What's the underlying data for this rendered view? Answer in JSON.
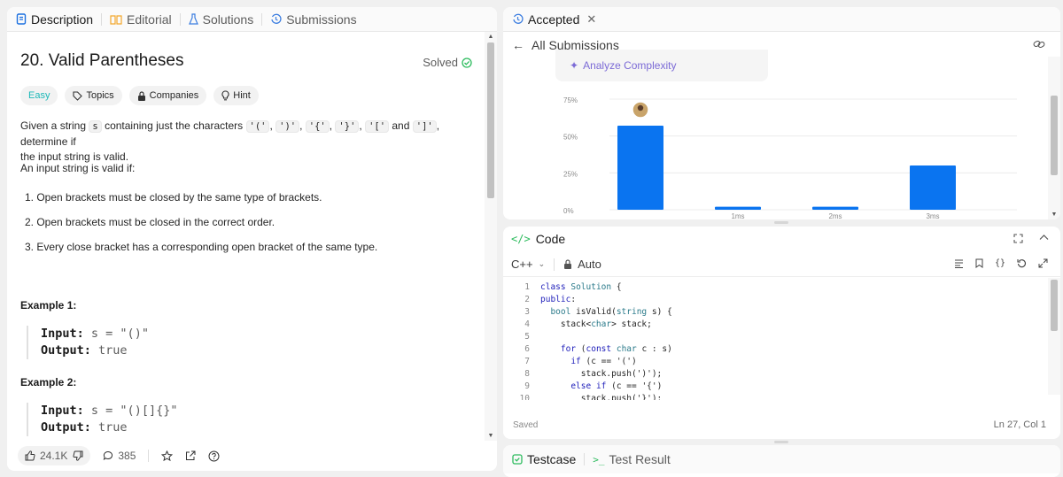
{
  "left": {
    "tabs": [
      {
        "label": "Description",
        "icon": "description-icon"
      },
      {
        "label": "Editorial",
        "icon": "book-icon"
      },
      {
        "label": "Solutions",
        "icon": "flask-icon"
      },
      {
        "label": "Submissions",
        "icon": "history-icon"
      }
    ],
    "problem": {
      "title": "20. Valid Parentheses",
      "status": "Solved",
      "tags": [
        "Easy",
        "Topics",
        "Companies",
        "Hint"
      ],
      "statement_prefix": "Given a string",
      "statement_var": "s",
      "statement_mid": "containing just the characters",
      "chars": [
        "'('",
        "')'",
        "'{'",
        "'}'",
        "'['"
      ],
      "and_word": "and",
      "last_char": "']'",
      "statement_suffix": ", determine if",
      "statement_line2": "the input string is valid.",
      "valid_if": "An input string is valid if:",
      "rules": [
        "1. Open brackets must be closed by the same type of brackets.",
        "2. Open brackets must be closed in the correct order.",
        "3. Every close bracket has a corresponding open bracket of the same type."
      ],
      "examples": [
        {
          "heading": "Example 1:",
          "input_label": "Input:",
          "input_value": "s = \"()\"",
          "output_label": "Output:",
          "output_value": "true"
        },
        {
          "heading": "Example 2:",
          "input_label": "Input:",
          "input_value": "s = \"()[]{}\"",
          "output_label": "Output:",
          "output_value": "true"
        }
      ]
    },
    "footer": {
      "likes": "24.1K",
      "comments": "385"
    }
  },
  "submission": {
    "tab_label": "Accepted",
    "back_label": "All Submissions",
    "analyze_label": "Analyze Complexity"
  },
  "chart_data": {
    "type": "bar",
    "categories": [
      "",
      "1ms",
      "2ms",
      "3ms"
    ],
    "values": [
      57,
      2,
      2,
      30
    ],
    "yticks": [
      "75%",
      "50%",
      "25%",
      "0%"
    ],
    "ylim": [
      0,
      75
    ],
    "bar_color": "#0a74f0",
    "highlight_index": 0
  },
  "code": {
    "title": "Code",
    "language": "C++",
    "mode": "Auto",
    "lines": [
      {
        "n": "1",
        "text": "class Solution {"
      },
      {
        "n": "2",
        "text": "public:"
      },
      {
        "n": "3",
        "text": "  bool isValid(string s) {"
      },
      {
        "n": "4",
        "text": "    stack<char> stack;"
      },
      {
        "n": "5",
        "text": ""
      },
      {
        "n": "6",
        "text": "    for (const char c : s)"
      },
      {
        "n": "7",
        "text": "      if (c == '(')"
      },
      {
        "n": "8",
        "text": "        stack.push(')');"
      },
      {
        "n": "9",
        "text": "      else if (c == '{')"
      },
      {
        "n": "10",
        "text": "        stack.push('}');"
      }
    ],
    "saved_label": "Saved",
    "cursor_pos": "Ln 27, Col 1"
  },
  "bottom": {
    "testcase_label": "Testcase",
    "result_label": "Test Result"
  },
  "colors": {
    "accent_green": "#2cbb5d",
    "easy": "#1cb8b8",
    "bar": "#0a74f0",
    "analyze": "#7c6bd6"
  }
}
